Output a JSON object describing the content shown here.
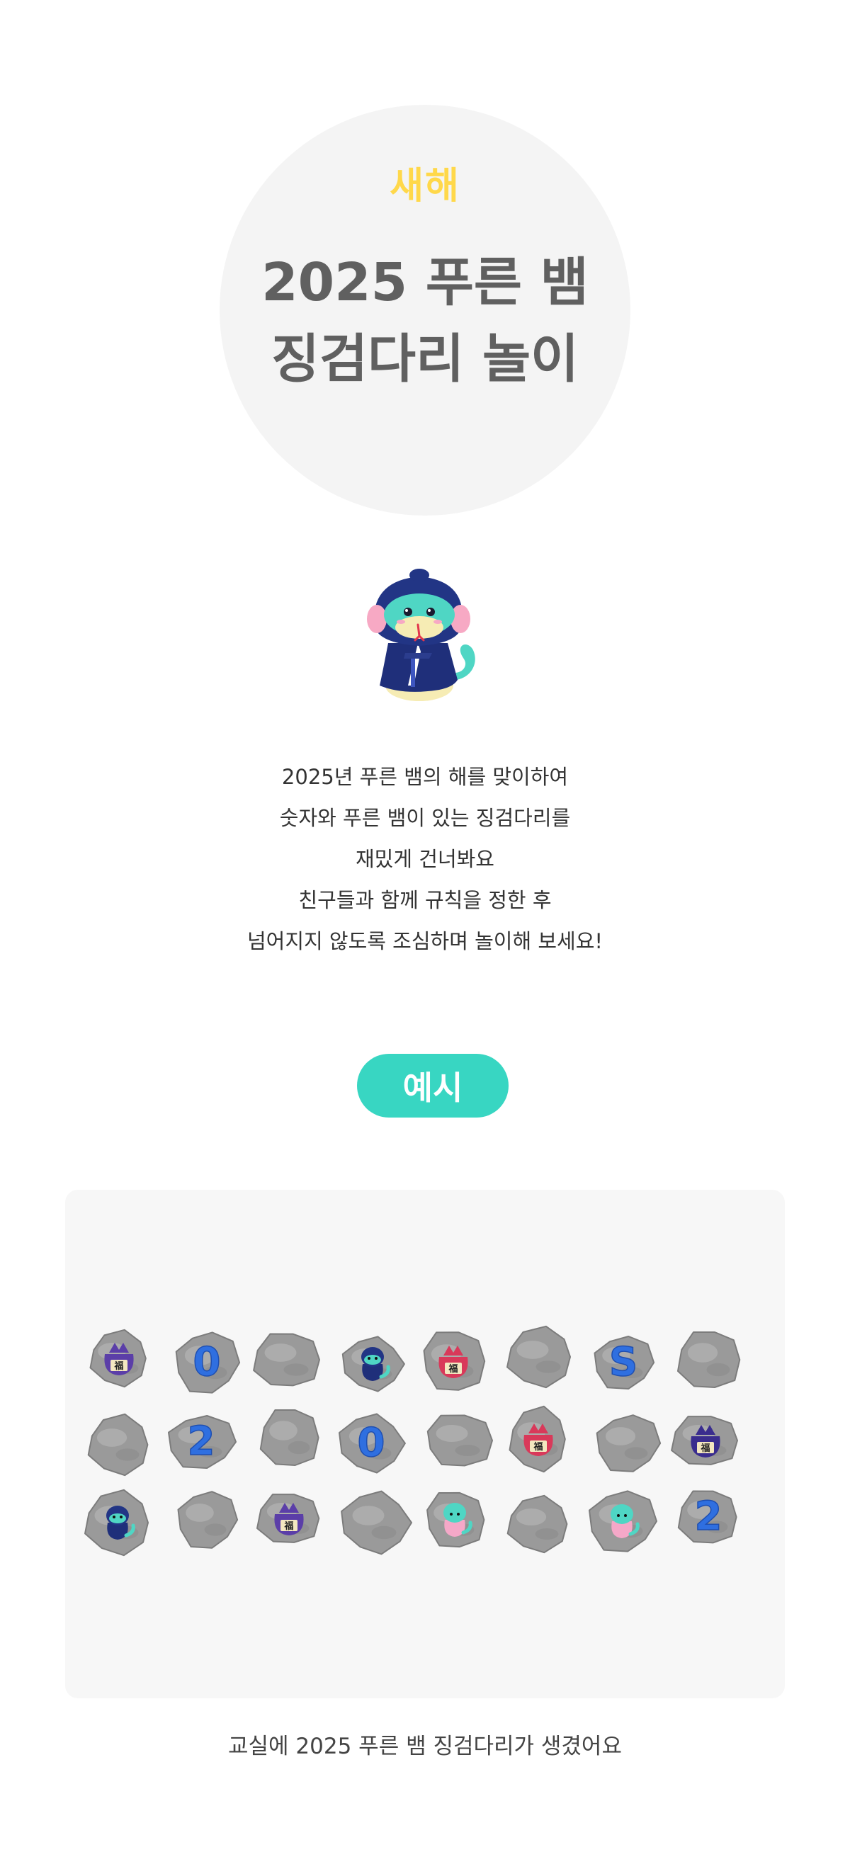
{
  "hero": {
    "eyebrow": "새해",
    "title_line1": "2025 푸른 뱀",
    "title_line2": "징검다리 놀이"
  },
  "mascot": {
    "icon": "blue-snake-hanbok-mascot-icon"
  },
  "intro": {
    "lines": [
      "2025년 푸른 뱀의 해를 맞이하여",
      "숫자와 푸른 뱀이 있는 징검다리를",
      "재밌게 건너봐요",
      "친구들과 함께 규칙을 정한 후",
      "넘어지지 않도록 조심하며 놀이해 보세요!"
    ]
  },
  "example_label": "예시",
  "stepping_stones": {
    "rows": [
      [
        {
          "content": "bag",
          "bag_color": "#5b3ea8"
        },
        {
          "content": "digit",
          "label": "0"
        },
        {
          "content": "plain"
        },
        {
          "content": "snake",
          "snake_color": "navy"
        },
        {
          "content": "bag",
          "bag_color": "#d9395a"
        },
        {
          "content": "plain"
        },
        {
          "content": "digit",
          "label": "S"
        },
        {
          "content": "plain"
        }
      ],
      [
        {
          "content": "plain"
        },
        {
          "content": "digit",
          "label": "2"
        },
        {
          "content": "plain"
        },
        {
          "content": "digit",
          "label": "0"
        },
        {
          "content": "plain"
        },
        {
          "content": "bag",
          "bag_color": "#d9395a"
        },
        {
          "content": "plain"
        },
        {
          "content": "bag",
          "bag_color": "#3a2d8e"
        }
      ],
      [
        {
          "content": "snake",
          "snake_color": "navy"
        },
        {
          "content": "plain"
        },
        {
          "content": "bag",
          "bag_color": "#5b3ea8"
        },
        {
          "content": "plain"
        },
        {
          "content": "snake",
          "snake_color": "pink"
        },
        {
          "content": "plain"
        },
        {
          "content": "snake",
          "snake_color": "pink"
        },
        {
          "content": "digit",
          "label": "2"
        }
      ]
    ],
    "bag_label": "福",
    "digit_color": "#2f6fe0",
    "stone_color": "#9a9a9a"
  },
  "caption": "교실에 2025 푸른 뱀 징검다리가 생겼어요"
}
